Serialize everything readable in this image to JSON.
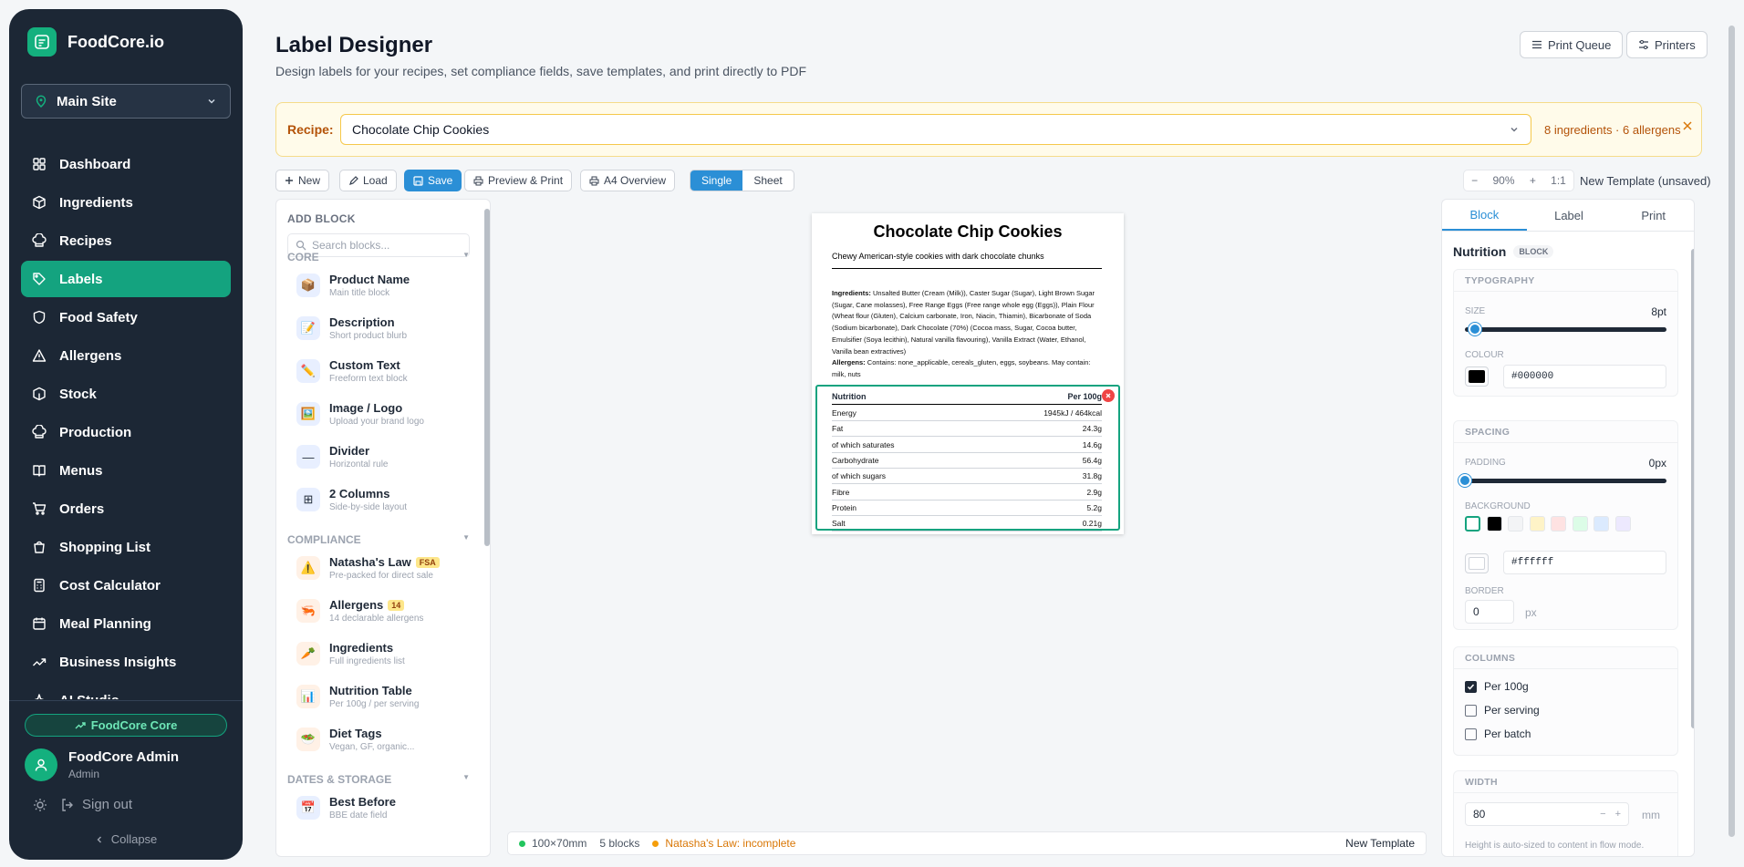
{
  "app": {
    "brand": "FoodCore.io",
    "site": "Main Site"
  },
  "nav": [
    {
      "label": "Dashboard",
      "icon": "grid-icon"
    },
    {
      "label": "Ingredients",
      "icon": "box-icon"
    },
    {
      "label": "Recipes",
      "icon": "chef-hat-icon"
    },
    {
      "label": "Labels",
      "icon": "tag-icon",
      "active": true
    },
    {
      "label": "Food Safety",
      "icon": "shield-icon"
    },
    {
      "label": "Allergens",
      "icon": "alert-icon"
    },
    {
      "label": "Stock",
      "icon": "cube-icon"
    },
    {
      "label": "Production",
      "icon": "chef-hat-icon"
    },
    {
      "label": "Menus",
      "icon": "book-icon"
    },
    {
      "label": "Orders",
      "icon": "cart-icon"
    },
    {
      "label": "Shopping List",
      "icon": "bag-icon"
    },
    {
      "label": "Cost Calculator",
      "icon": "calculator-icon"
    },
    {
      "label": "Meal Planning",
      "icon": "calendar-icon"
    },
    {
      "label": "Business Insights",
      "icon": "trend-icon"
    },
    {
      "label": "AI Studio",
      "icon": "sparkle-icon"
    }
  ],
  "sidebar_footer": {
    "plan": "FoodCore Core",
    "user_name": "FoodCore Admin",
    "user_role": "Admin",
    "sign_out": "Sign out",
    "collapse": "Collapse"
  },
  "header": {
    "title": "Label Designer",
    "subtitle": "Design labels for your recipes, set compliance fields, save templates, and print directly to PDF",
    "print_queue": "Print Queue",
    "printers": "Printers"
  },
  "recipe_bar": {
    "label": "Recipe:",
    "selected": "Chocolate Chip Cookies",
    "info": "8 ingredients · 6 allergens"
  },
  "toolbar": {
    "new": "New",
    "load": "Load",
    "save": "Save",
    "preview": "Preview & Print",
    "a4": "A4 Overview",
    "single": "Single",
    "sheet": "Sheet",
    "zoom_minus": "−",
    "zoom": "90%",
    "zoom_plus": "+",
    "zoom_reset": "1:1",
    "template_name": "New Template (unsaved)"
  },
  "blocks_panel": {
    "heading": "ADD BLOCK",
    "search_placeholder": "Search blocks...",
    "sections": [
      {
        "title": "CORE",
        "items": [
          {
            "name": "Product Name",
            "sub": "Main title block",
            "icon": "📦"
          },
          {
            "name": "Description",
            "sub": "Short product blurb",
            "icon": "📝"
          },
          {
            "name": "Custom Text",
            "sub": "Freeform text block",
            "icon": "✏️"
          },
          {
            "name": "Image / Logo",
            "sub": "Upload your brand logo",
            "icon": "🖼️"
          },
          {
            "name": "Divider",
            "sub": "Horizontal rule",
            "icon": "—"
          },
          {
            "name": "2 Columns",
            "sub": "Side-by-side layout",
            "icon": "⊞"
          }
        ]
      },
      {
        "title": "COMPLIANCE",
        "items": [
          {
            "name": "Natasha's Law",
            "sub": "Pre-packed for direct sale",
            "icon": "⚠️",
            "tag": "FSA"
          },
          {
            "name": "Allergens",
            "sub": "14 declarable allergens",
            "icon": "🦐",
            "tag": "14"
          },
          {
            "name": "Ingredients",
            "sub": "Full ingredients list",
            "icon": "🥕"
          },
          {
            "name": "Nutrition Table",
            "sub": "Per 100g / per serving",
            "icon": "📊"
          },
          {
            "name": "Diet Tags",
            "sub": "Vegan, GF, organic...",
            "icon": "🥗"
          }
        ]
      },
      {
        "title": "DATES & STORAGE",
        "items": [
          {
            "name": "Best Before",
            "sub": "BBE date field",
            "icon": "📅"
          }
        ]
      }
    ]
  },
  "label": {
    "title": "Chocolate Chip Cookies",
    "description": "Chewy American-style cookies with dark chocolate chunks",
    "ingredients_label": "Ingredients:",
    "ingredients_text": "Unsalted Butter (Cream (Milk)), Caster Sugar (Sugar), Light Brown Sugar (Sugar, Cane molasses), Free Range Eggs (Free range whole egg (Eggs)), Plain Flour (Wheat flour (Gluten), Calcium carbonate, Iron, Niacin, Thiamin), Bicarbonate of Soda (Sodium bicarbonate), Dark Chocolate (70%) (Cocoa mass, Sugar, Cocoa butter, Emulsifier (Soya lecithin), Natural vanilla flavouring), Vanilla Extract (Water, Ethanol, Vanilla bean extractives)",
    "allergens_label": "Allergens:",
    "allergens_text": "Contains: none_applicable, cereals_gluten, eggs, soybeans. May contain: milk, nuts",
    "nutrition": {
      "header": "Nutrition",
      "per": "Per 100g",
      "rows": [
        {
          "name": "Energy",
          "value": "1945kJ / 464kcal"
        },
        {
          "name": "Fat",
          "value": "24.3g"
        },
        {
          "name": "of which saturates",
          "value": "14.6g"
        },
        {
          "name": "Carbohydrate",
          "value": "56.4g"
        },
        {
          "name": "of which sugars",
          "value": "31.8g"
        },
        {
          "name": "Fibre",
          "value": "2.9g"
        },
        {
          "name": "Protein",
          "value": "5.2g"
        },
        {
          "name": "Salt",
          "value": "0.21g"
        }
      ]
    }
  },
  "status": {
    "size": "100×70mm",
    "blocks": "5 blocks",
    "compliance": "Natasha's Law: incomplete",
    "template": "New Template"
  },
  "props": {
    "tabs": [
      "Block",
      "Label",
      "Print"
    ],
    "block_name": "Nutrition",
    "block_tag": "BLOCK",
    "typography": {
      "title": "TYPOGRAPHY",
      "size_label": "SIZE",
      "size_value": "8pt",
      "size_fraction": 0.05,
      "colour_label": "COLOUR",
      "colour_value": "#000000"
    },
    "spacing": {
      "title": "SPACING",
      "padding_label": "PADDING",
      "padding_value": "0px",
      "padding_fraction": 0.0,
      "background_label": "BACKGROUND",
      "background_value": "#ffffff",
      "swatches": [
        "#ffffff",
        "#000000",
        "#f3f4f6",
        "#fef3c7",
        "#fee2e2",
        "#dcfce7",
        "#dbeafe",
        "#ede9fe"
      ],
      "border_label": "BORDER",
      "border_value": "0",
      "border_unit": "px"
    },
    "columns": {
      "title": "COLUMNS",
      "options": [
        {
          "label": "Per 100g",
          "checked": true
        },
        {
          "label": "Per serving",
          "checked": false
        },
        {
          "label": "Per batch",
          "checked": false
        }
      ]
    },
    "width": {
      "title": "WIDTH",
      "value": "80",
      "unit": "mm",
      "hint": "Height is auto-sized to content in flow mode."
    }
  },
  "colors": {
    "accent": "#14a37f",
    "primary": "#2b8fd6",
    "sidebar": "#1c2735",
    "warning": "#b45309"
  }
}
